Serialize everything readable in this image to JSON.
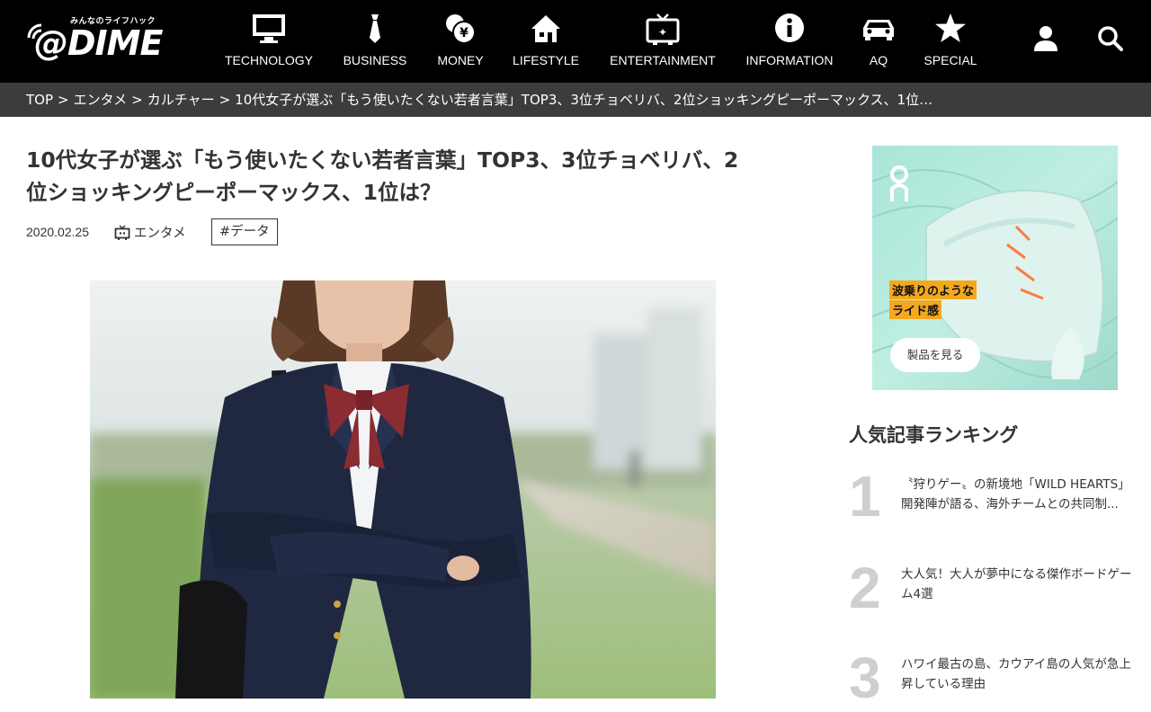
{
  "header": {
    "logo_sub": "みんなのライフハック",
    "logo_main": "@DIME",
    "nav": [
      {
        "label": "TECHNOLOGY",
        "icon": "monitor-icon"
      },
      {
        "label": "BUSINESS",
        "icon": "necktie-icon"
      },
      {
        "label": "MONEY",
        "icon": "coins-yen-icon"
      },
      {
        "label": "LIFESTYLE",
        "icon": "house-icon"
      },
      {
        "label": "ENTERTAINMENT",
        "icon": "tv-icon"
      },
      {
        "label": "INFORMATION",
        "icon": "info-icon"
      },
      {
        "label": "AQ",
        "icon": "car-icon"
      },
      {
        "label": "SPECIAL",
        "icon": "star-icon"
      }
    ],
    "user_icon": "user-icon",
    "search_icon": "search-icon"
  },
  "breadcrumb": {
    "items": [
      "TOP",
      "エンタメ",
      "カルチャー",
      "10代女子が選ぶ「もう使いたくない若者言葉」TOP3、3位チョベリバ、2位ショッキングピーポーマックス、1位…"
    ],
    "separator": ">"
  },
  "article": {
    "title": "10代女子が選ぶ「もう使いたくない若者言葉」TOP3、3位チョベリバ、2位ショッキングピーポーマックス、1位は？",
    "date": "2020.02.25",
    "category": "エンタメ",
    "tag": "#データ"
  },
  "ad": {
    "brand": "on",
    "line1": "波乗りのような",
    "line2": "ライド感",
    "button": "製品を見る"
  },
  "ranking": {
    "title": "人気記事ランキング",
    "items": [
      {
        "num": "1",
        "text": "〝狩りゲー〟の新境地「WILD HEARTS」開発陣が語る、海外チームとの共同制..."
      },
      {
        "num": "2",
        "text": "大人気！大人が夢中になる傑作ボードゲーム4選"
      },
      {
        "num": "3",
        "text": "ハワイ最古の島、カウアイ島の人気が急上昇している理由"
      }
    ]
  }
}
